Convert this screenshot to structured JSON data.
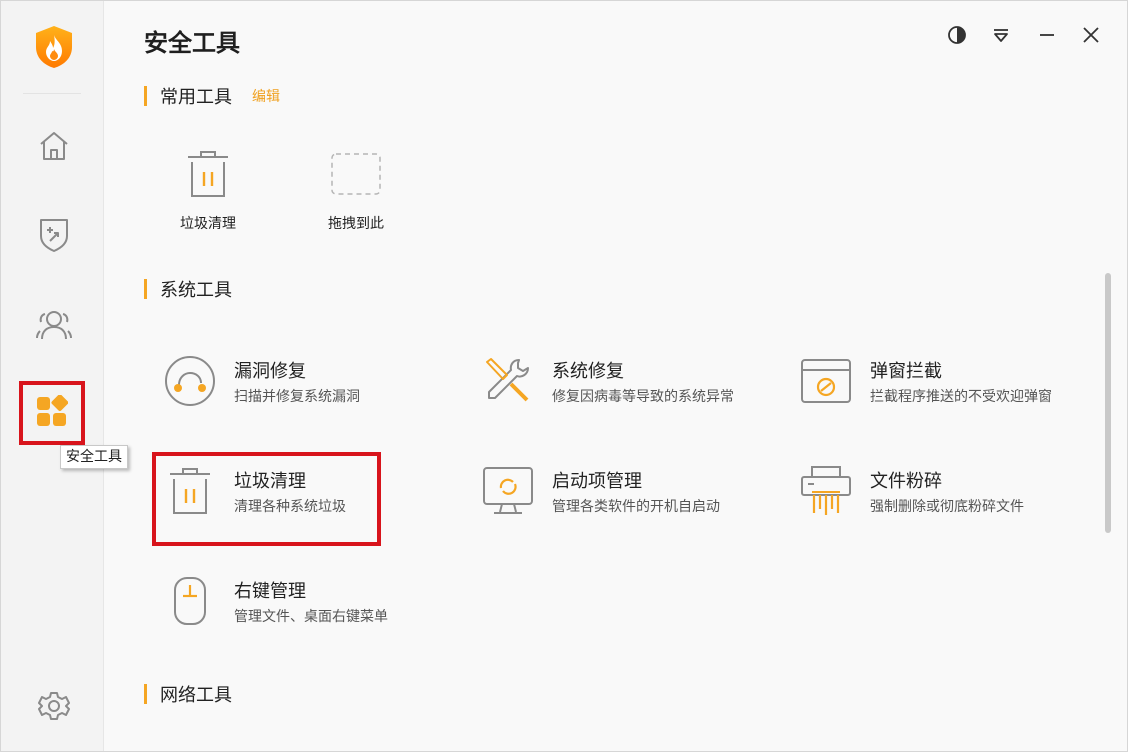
{
  "app": {
    "page_title": "安全工具",
    "tooltip": "安全工具"
  },
  "sidebar": {
    "items": [
      {
        "id": "home",
        "icon": "home-icon"
      },
      {
        "id": "shield",
        "icon": "shield-plus-icon"
      },
      {
        "id": "users",
        "icon": "users-icon"
      },
      {
        "id": "tools",
        "icon": "apps-grid-icon",
        "active": true
      },
      {
        "id": "settings",
        "icon": "gear-icon"
      }
    ]
  },
  "window_controls": [
    "theme-icon",
    "dropdown-icon",
    "minimize-icon",
    "close-icon"
  ],
  "sections": {
    "common": {
      "title": "常用工具",
      "edit_label": "编辑"
    },
    "system": {
      "title": "系统工具"
    },
    "network": {
      "title": "网络工具"
    }
  },
  "common_tools": [
    {
      "label": "垃圾清理",
      "icon": "trash-icon"
    },
    {
      "label": "拖拽到此",
      "icon": "dashed-placeholder-icon"
    }
  ],
  "system_tools": [
    {
      "name": "漏洞修复",
      "desc": "扫描并修复系统漏洞",
      "icon": "vulnerability-icon"
    },
    {
      "name": "系统修复",
      "desc": "修复因病毒等导致的系统异常",
      "icon": "wrench-screwdriver-icon"
    },
    {
      "name": "弹窗拦截",
      "desc": "拦截程序推送的不受欢迎弹窗",
      "icon": "popup-block-icon"
    },
    {
      "name": "垃圾清理",
      "desc": "清理各种系统垃圾",
      "icon": "trash-icon"
    },
    {
      "name": "启动项管理",
      "desc": "管理各类软件的开机自启动",
      "icon": "monitor-refresh-icon"
    },
    {
      "name": "文件粉碎",
      "desc": "强制删除或彻底粉碎文件",
      "icon": "shredder-icon"
    },
    {
      "name": "右键管理",
      "desc": "管理文件、桌面右键菜单",
      "icon": "mouse-icon"
    }
  ],
  "colors": {
    "accent_orange": "#f5a623",
    "highlight_red": "#d8141c",
    "icon_gray": "#8a8a8a"
  }
}
